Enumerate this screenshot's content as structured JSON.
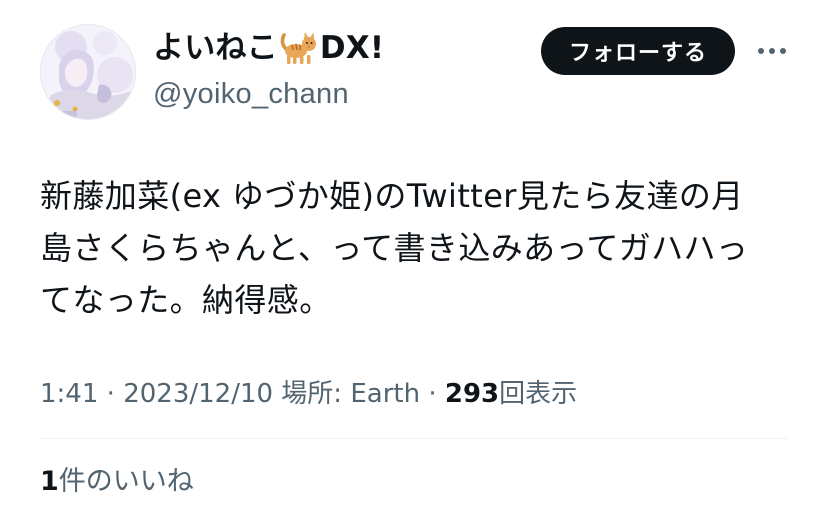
{
  "user": {
    "display_name_prefix": "よいねこ",
    "display_name_emoji": "cat-emoji",
    "display_name_suffix": "DX!",
    "handle": "@yoiko_chann",
    "avatar": "avatar-illustration"
  },
  "actions": {
    "follow_label": "フォローする",
    "more_icon": "more-dots-icon"
  },
  "tweet": {
    "lines": [
      "新藤加菜(ex ゆづか姫)のTwitter見たら友達の月",
      "島さくらちゃんと、って書き込みあってガハハっ",
      "てなった。納得感。"
    ]
  },
  "meta": {
    "time": "1:41",
    "sep1": " · ",
    "date": "2023/12/10",
    "location": " 場所: Earth",
    "sep2": " · ",
    "views_count": "293",
    "views_label": "回表示"
  },
  "likes": {
    "count": "1",
    "label": "件のいいね"
  },
  "colors": {
    "text_primary": "#0f1419",
    "text_secondary": "#536471",
    "button_bg": "#0f1419",
    "divider": "#eff3f4"
  }
}
